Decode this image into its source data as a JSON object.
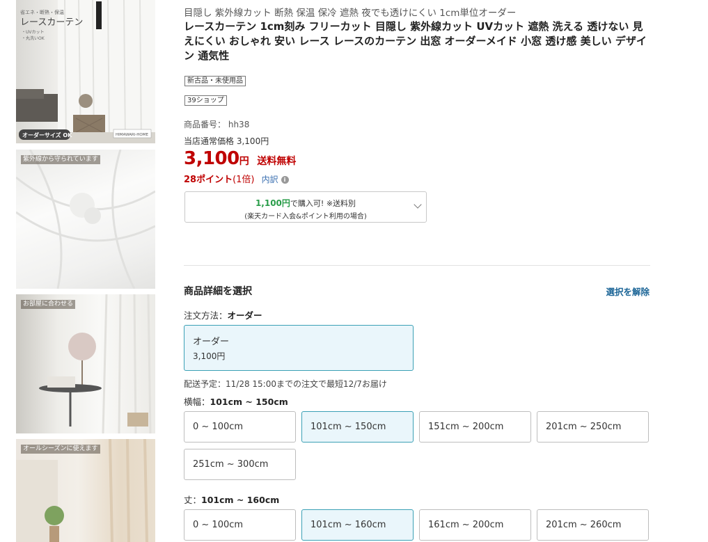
{
  "thumbnails": [
    {
      "name": "main-product-image",
      "caption": "",
      "overlay_title": "レースカーテン",
      "overlay_sub": "省エネ・断熱・保温",
      "overlay_bullets": [
        "・UVカット",
        "・丸洗いOK"
      ],
      "overlay_badge": "オーダーサイズ OK",
      "overlay_brand": "HIMAWARI-HOME"
    },
    {
      "name": "uv-image",
      "caption": "紫外線から守られています"
    },
    {
      "name": "room-image",
      "caption": "お部屋に合わせる"
    },
    {
      "name": "allseason-image",
      "caption": "オールシーズンに使えます"
    }
  ],
  "product": {
    "catch_copy": "目隠し 紫外線カット 断熱 保温 保冷 遮熱 夜でも透けにくい 1cm単位オーダー",
    "title": "レースカーテン 1cm刻み フリーカット 目隠し 紫外線カット UVカット 遮熱 洗える 透けない 見えにくい おしゃれ 安い レース レースのカーテン 出窓 オーダーメイド 小窓 透け感 美しい デザイン 通気性",
    "condition_badge": "新古品・未使用品",
    "shop_badge": "39ショップ",
    "code_label": "商品番号：",
    "code_value": "hh38",
    "regular_label": "当店通常価格",
    "regular_value": "3,100円",
    "price": "3,100",
    "price_unit": "円",
    "shipping": "送料無料",
    "points": "28ポイント",
    "points_multiplier": "(1倍)",
    "breakdown_label": "内訳",
    "card_offer_price": "1,100円",
    "card_offer_text": "で購入可! ※送料別",
    "card_offer_note": "(楽天カード入会&ポイント利用の場合)"
  },
  "options": {
    "section_title": "商品詳細を選択",
    "clear_label": "選択を解除",
    "method_label": "注文方法：",
    "method_value": "オーダー",
    "method_choice": {
      "name": "オーダー",
      "price": "3,100円",
      "selected": true
    },
    "delivery": "配送予定：11/28 15:00までの注文で最短12/7お届け",
    "width_label": "横幅：",
    "width_value": "101cm ~ 150cm",
    "width_choices": [
      {
        "label": "0 ~ 100cm",
        "selected": false
      },
      {
        "label": "101cm ~ 150cm",
        "selected": true
      },
      {
        "label": "151cm ~ 200cm",
        "selected": false
      },
      {
        "label": "201cm ~ 250cm",
        "selected": false
      },
      {
        "label": "251cm ~ 300cm",
        "selected": false
      }
    ],
    "height_label": "丈：",
    "height_value": "101cm ~ 160cm",
    "height_choices": [
      {
        "label": "0 ~ 100cm",
        "selected": false
      },
      {
        "label": "101cm ~ 160cm",
        "selected": true
      },
      {
        "label": "161cm ~ 200cm",
        "selected": false
      },
      {
        "label": "201cm ~ 260cm",
        "selected": false
      }
    ]
  },
  "colors": {
    "price_red": "#bf0000",
    "offer_green": "#2a9d4a",
    "link_blue": "#1a6496",
    "selected_border": "#3aa0b5",
    "selected_bg": "#eaf6fb"
  }
}
